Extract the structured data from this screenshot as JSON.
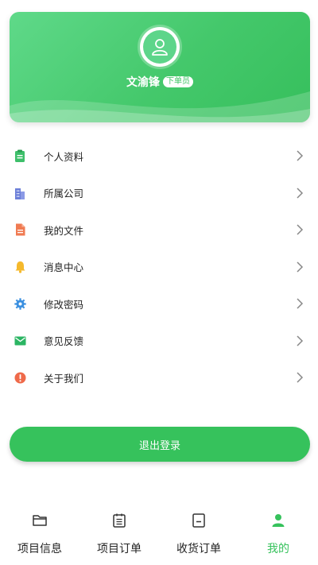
{
  "profile": {
    "user_name": "文渝锋",
    "role_badge": "下单员",
    "card_color": "#44c86b"
  },
  "menu": {
    "items": [
      {
        "label": "个人资料",
        "icon": "clipboard-icon",
        "color": "#3dbf6a"
      },
      {
        "label": "所属公司",
        "icon": "building-icon",
        "color": "#6c7fd8"
      },
      {
        "label": "我的文件",
        "icon": "file-icon",
        "color": "#f07b52"
      },
      {
        "label": "消息中心",
        "icon": "bell-icon",
        "color": "#f5b92c"
      },
      {
        "label": "修改密码",
        "icon": "gear-icon",
        "color": "#3a8fe0"
      },
      {
        "label": "意见反馈",
        "icon": "mail-icon",
        "color": "#2bb563"
      },
      {
        "label": "关于我们",
        "icon": "info-icon",
        "color": "#ef6a4a"
      }
    ]
  },
  "logout": {
    "label": "退出登录"
  },
  "tabbar": {
    "tabs": [
      {
        "label": "项目信息",
        "icon": "folder-icon",
        "active": false
      },
      {
        "label": "项目订单",
        "icon": "list-clipboard-icon",
        "active": false
      },
      {
        "label": "收货订单",
        "icon": "receipt-icon",
        "active": false
      },
      {
        "label": "我的",
        "icon": "user-icon",
        "active": true
      }
    ],
    "active_color": "#36c25c"
  }
}
